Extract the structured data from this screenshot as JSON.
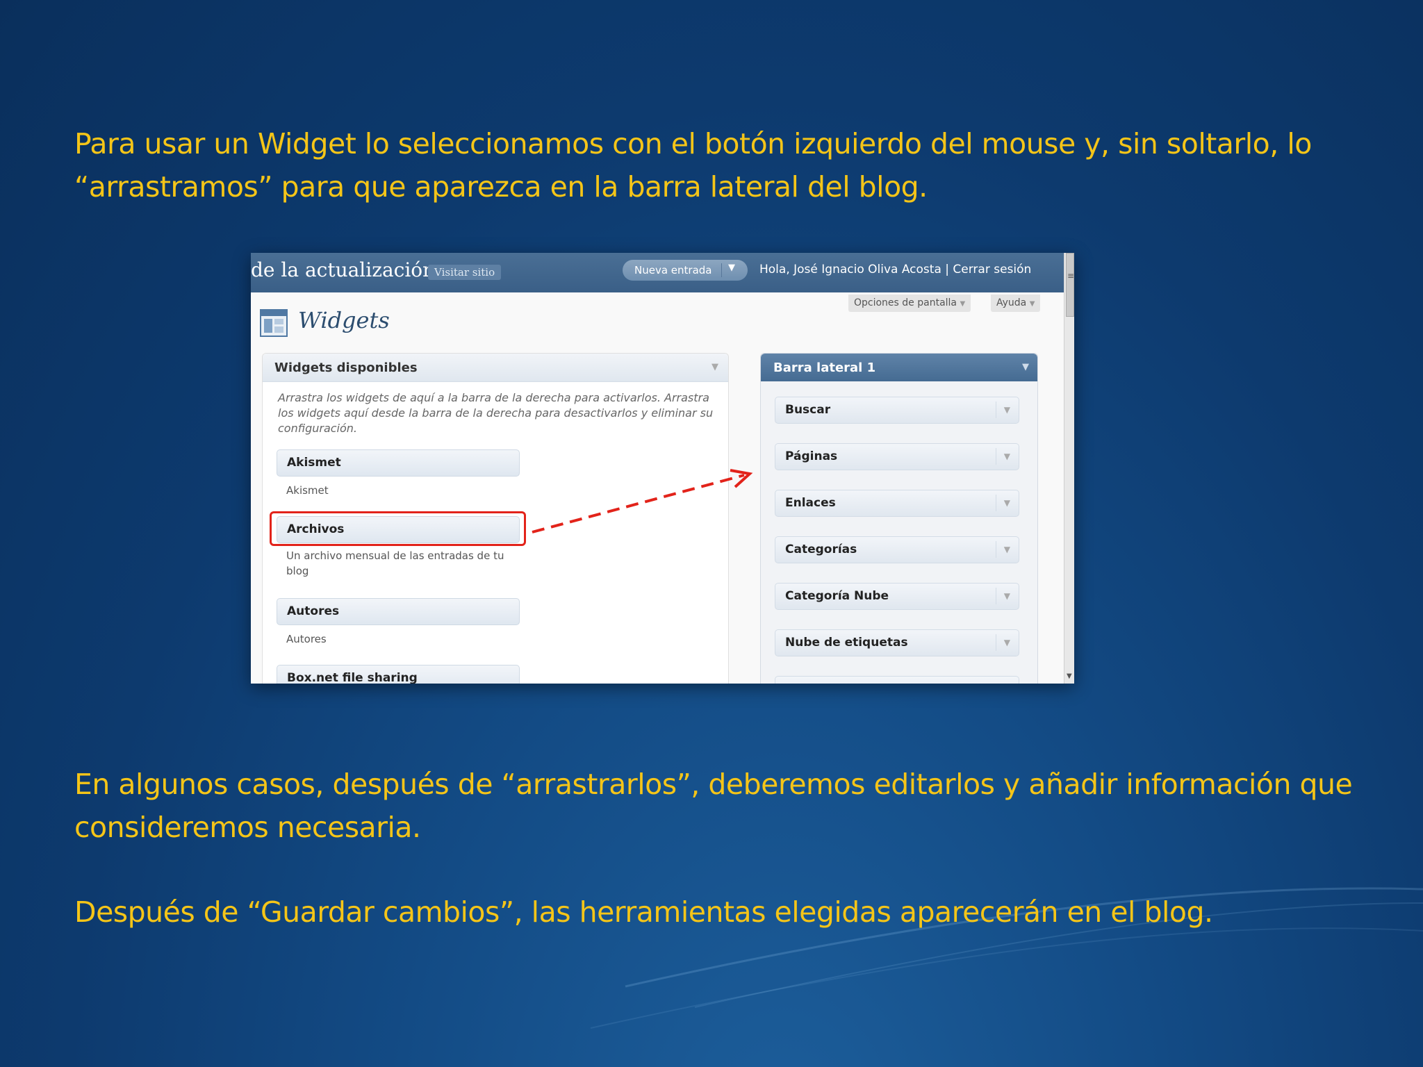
{
  "slide": {
    "text_top": "Para usar un Widget lo seleccionamos con el botón izquierdo del mouse y, sin soltarlo, lo “arrastramos” para que aparezca en la barra lateral del blog.",
    "text_middle": "En algunos casos, después de “arrastrarlos”, deberemos editarlos y añadir información que consideremos  necesaria.",
    "text_bottom": "Después de  “Guardar cambios”, las herramientas elegidas  aparecerán en el blog.",
    "text_color": "#f5c518"
  },
  "screenshot": {
    "header": {
      "site_title": "de la actualización",
      "visit_site": "Visitar sitio",
      "new_entry": "Nueva entrada",
      "dropdown_icon": "chevron-down-icon",
      "greeting": "Hola, José Ignacio Oliva Acosta | Cerrar sesión"
    },
    "tabs": {
      "screen_options": "Opciones de pantalla",
      "help": "Ayuda"
    },
    "page_title": "Widgets",
    "available": {
      "title": "Widgets disponibles",
      "description": "Arrastra los widgets de aquí a la barra de la derecha para activarlos. Arrastra los widgets aquí desde la barra de la derecha para desactivarlos y eliminar su configuración.",
      "widgets": [
        {
          "name": "Akismet",
          "desc": "Akismet"
        },
        {
          "name": "Archivos",
          "desc": "Un archivo mensual de las entradas de tu blog"
        },
        {
          "name": "Autores",
          "desc": "Autores"
        },
        {
          "name": "Box.net file sharing",
          "desc": ""
        }
      ],
      "highlighted": "Archivos"
    },
    "sidebar": {
      "title": "Barra lateral 1",
      "widgets": [
        "Buscar",
        "Páginas",
        "Enlaces",
        "Categorías",
        "Categoría Nube",
        "Nube de etiquetas"
      ]
    },
    "colors": {
      "header_bg": "#3a5f87",
      "highlight": "#e2231a"
    }
  }
}
